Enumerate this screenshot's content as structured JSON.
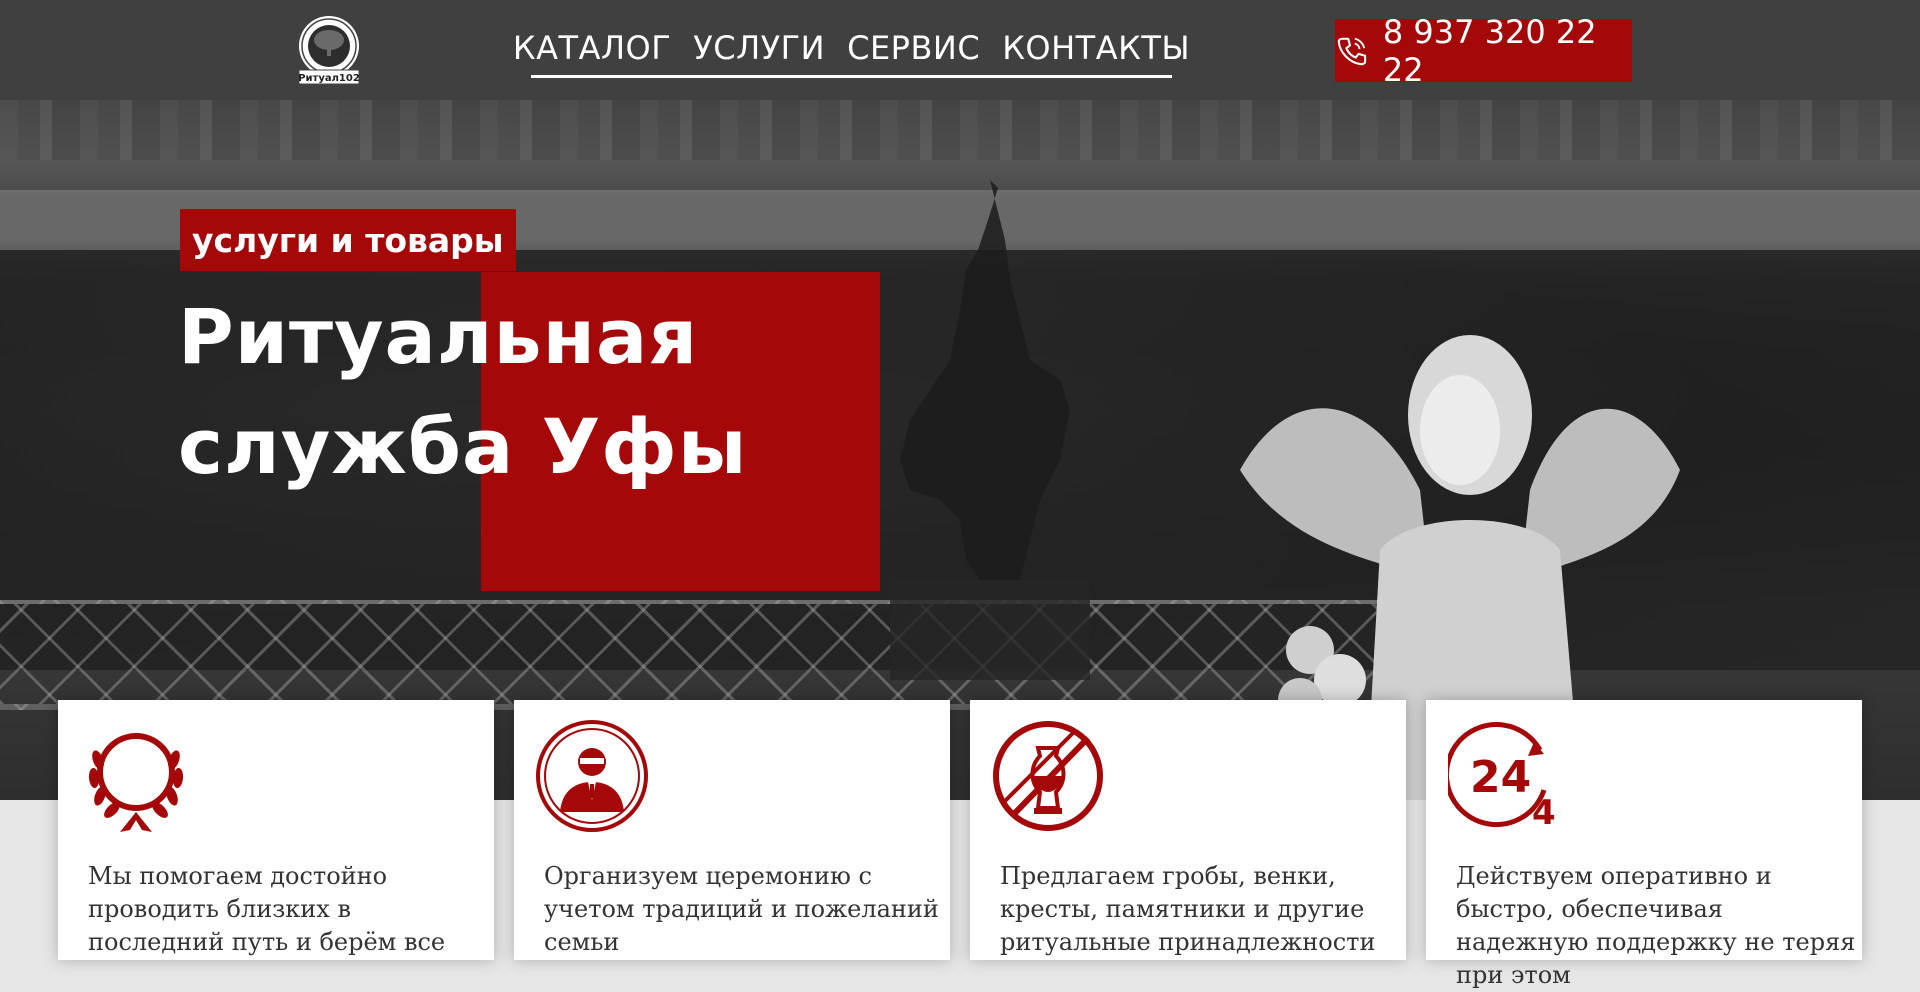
{
  "header": {
    "logo_label": "Ритуал102",
    "nav": [
      "КАТАЛОГ",
      "УСЛУГИ",
      "СЕРВИС",
      "КОНТАКТЫ"
    ],
    "phone": "8 937 320 22 22"
  },
  "hero": {
    "tag": "услуги и товары",
    "title_line1": "Ритуальная",
    "title_line2": "служба Уфы"
  },
  "cards": [
    {
      "icon": "wreath-icon",
      "text": "Мы помогаем достойно проводить близких в последний путь и берём все"
    },
    {
      "icon": "funeral-agent-icon",
      "text": "Организуем церемонию с учетом традиций и пожеланий семьи"
    },
    {
      "icon": "urn-icon",
      "text": "Предлагаем гробы, венки, кресты, памятники и другие ритуальные принадлежности"
    },
    {
      "icon": "24-7-icon",
      "text": "Действуем оперативно и быстро, обеспечивая надежную поддержку не теряя при этом"
    }
  ],
  "colors": {
    "accent": "#a50808",
    "header_bg": "#404040",
    "card_bg": "#ffffff"
  }
}
